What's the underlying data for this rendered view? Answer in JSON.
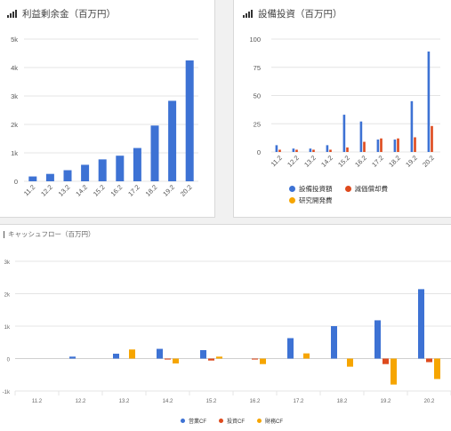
{
  "panel1": {
    "title": "利益剰余金（百万円）"
  },
  "panel2": {
    "title": "設備投資（百万円）"
  },
  "panel3": {
    "title": "キャッシュフロー（百万円）"
  },
  "chart_data": [
    {
      "type": "bar",
      "title": "利益剰余金（百万円）",
      "categories": [
        "11.2",
        "12.2",
        "13.2",
        "14.2",
        "15.2",
        "16.2",
        "17.2",
        "18.2",
        "19.2",
        "20.2"
      ],
      "yticks": [
        "0",
        "1k",
        "2k",
        "3k",
        "4k",
        "5k"
      ],
      "ylim": [
        0,
        5000
      ],
      "grid": true,
      "series": [
        {
          "color": "#3d72d4",
          "values": [
            170,
            260,
            390,
            580,
            770,
            900,
            1170,
            1960,
            2830,
            4250
          ]
        }
      ]
    },
    {
      "type": "bar",
      "title": "設備投資（百万円）",
      "categories": [
        "11.2",
        "12.2",
        "13.2",
        "14.2",
        "15.2",
        "16.2",
        "17.2",
        "18.2",
        "19.2",
        "20.2"
      ],
      "yticks": [
        "0",
        "25",
        "50",
        "75",
        "100"
      ],
      "ylim": [
        0,
        100
      ],
      "grid": true,
      "legend_position": "bottom",
      "series": [
        {
          "name": "設備投資額",
          "color": "#3d72d4",
          "values": [
            6,
            3,
            3,
            6,
            33,
            27,
            11,
            11,
            45,
            89
          ]
        },
        {
          "name": "減価償却費",
          "color": "#de4a1d",
          "values": [
            2,
            2,
            2,
            2,
            4,
            9,
            12,
            12,
            13,
            23
          ]
        },
        {
          "name": "研究開発費",
          "color": "#f6a500",
          "values": [
            0,
            0,
            0,
            0,
            0,
            0,
            0,
            0,
            0,
            0
          ]
        }
      ]
    },
    {
      "type": "bar",
      "title": "キャッシュフロー（百万円）",
      "categories": [
        "11.2",
        "12.2",
        "13.2",
        "14.2",
        "15.2",
        "16.2",
        "17.2",
        "18.2",
        "19.2",
        "20.2"
      ],
      "yticks": [
        "-1k",
        "0",
        "1k",
        "2k",
        "3k"
      ],
      "ylim": [
        -1000,
        3000
      ],
      "grid": true,
      "legend_position": "bottom",
      "series": [
        {
          "name": "営業CF",
          "color": "#3d72d4",
          "values": [
            0,
            60,
            150,
            300,
            260,
            0,
            630,
            1000,
            1180,
            2140
          ]
        },
        {
          "name": "投資CF",
          "color": "#de4a1d",
          "values": [
            0,
            0,
            0,
            -30,
            -60,
            -30,
            0,
            0,
            -170,
            -110
          ]
        },
        {
          "name": "財務CF",
          "color": "#f6a500",
          "values": [
            0,
            0,
            280,
            -150,
            60,
            -170,
            160,
            -250,
            -800,
            -630
          ]
        }
      ]
    }
  ]
}
